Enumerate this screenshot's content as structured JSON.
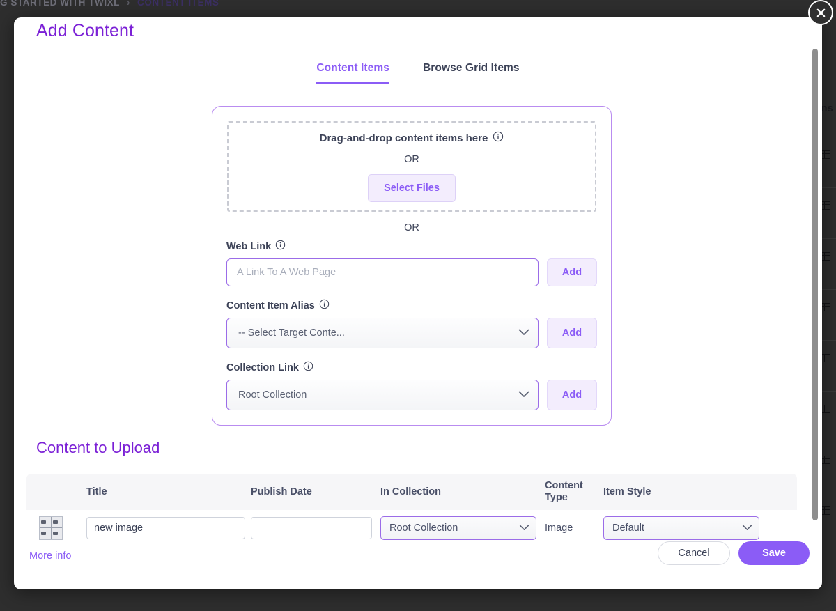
{
  "background": {
    "breadcrumb": {
      "prev": "G STARTED WITH TWIXL",
      "separator": "›",
      "current": "CONTENT ITEMS"
    },
    "table_header_actions": "ons",
    "row_icon": "grid-icon",
    "row_count": 8
  },
  "modal": {
    "title": "Add Content",
    "close_icon": "close-icon",
    "tabs": [
      {
        "label": "Content Items",
        "active": true
      },
      {
        "label": "Browse Grid Items",
        "active": false
      }
    ],
    "dropzone": {
      "text": "Drag-and-drop content items here",
      "info_icon": "info-icon",
      "or": "OR",
      "select_files_label": "Select Files"
    },
    "or_divider": "OR",
    "web_link": {
      "label": "Web Link",
      "info_icon": "info-icon",
      "placeholder": "A Link To A Web Page",
      "value": "",
      "add_label": "Add"
    },
    "content_item_alias": {
      "label": "Content Item Alias",
      "info_icon": "info-icon",
      "selected": "-- Select Target Conte...",
      "add_label": "Add"
    },
    "collection_link": {
      "label": "Collection Link",
      "info_icon": "info-icon",
      "selected": "Root Collection",
      "add_label": "Add"
    },
    "content_to_upload": {
      "title": "Content to Upload",
      "columns": {
        "thumb": "",
        "title": "Title",
        "publish_date": "Publish Date",
        "in_collection": "In Collection",
        "content_type": "Content\nType",
        "content_type_line1": "Content",
        "content_type_line2": "Type",
        "item_style": "Item Style"
      },
      "rows": [
        {
          "thumbnail": "image-thumbnail",
          "title": "new image",
          "publish_date": "",
          "publish_date_placeholder": "",
          "in_collection": "Root Collection",
          "content_type": "Image",
          "item_style": "Default"
        }
      ]
    },
    "footer": {
      "more_info": "More info",
      "cancel_label": "Cancel",
      "save_label": "Save"
    }
  },
  "colors": {
    "accent_purple": "#8b5cf6",
    "title_purple": "#7b20d6",
    "text_dark": "#3c4257",
    "overlay": "#2e2e2e"
  }
}
